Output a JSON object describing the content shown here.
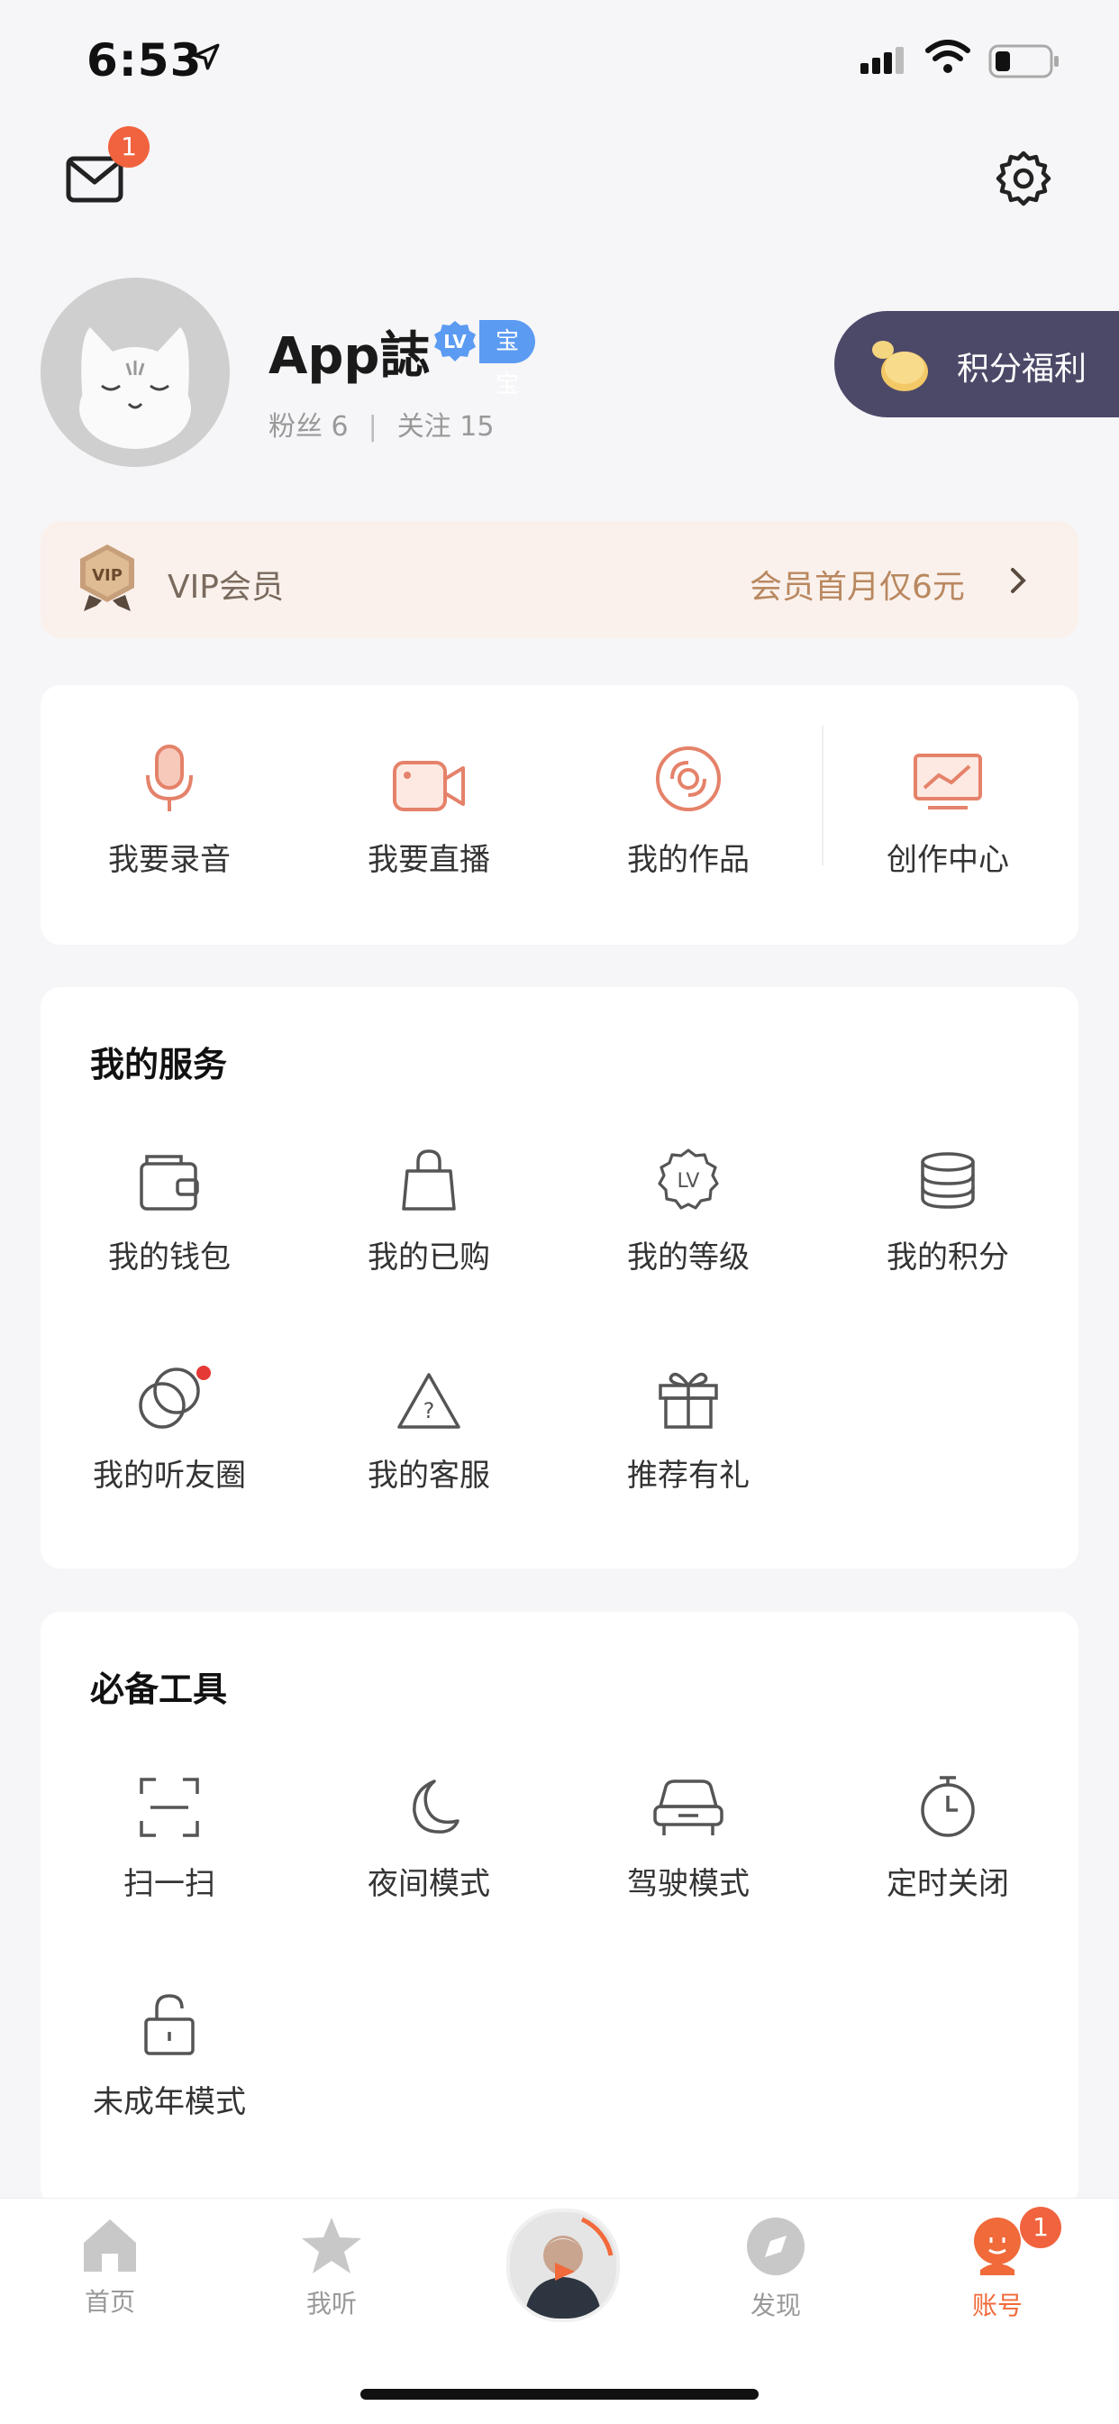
{
  "status_bar": {
    "time": "6:53"
  },
  "top_bar": {
    "mail_badge": "1"
  },
  "profile": {
    "name": "App誌",
    "level_badge": "LV",
    "level_label": "宝宝",
    "fans_label": "粉丝",
    "fans_count": "6",
    "following_label": "关注",
    "following_count": "15",
    "points_button": "积分福利"
  },
  "vip": {
    "badge": "VIP",
    "title": "VIP会员",
    "offer": "会员首月仅6元"
  },
  "creator": {
    "items": [
      {
        "label": "我要录音",
        "icon": "microphone-icon"
      },
      {
        "label": "我要直播",
        "icon": "video-camera-icon"
      },
      {
        "label": "我的作品",
        "icon": "disc-icon"
      },
      {
        "label": "创作中心",
        "icon": "monitor-chart-icon"
      }
    ]
  },
  "services": {
    "title": "我的服务",
    "items": [
      {
        "label": "我的钱包",
        "icon": "wallet-icon"
      },
      {
        "label": "我的已购",
        "icon": "shopping-bag-icon"
      },
      {
        "label": "我的等级",
        "icon": "level-badge-icon",
        "icon_text": "LV"
      },
      {
        "label": "我的积分",
        "icon": "coins-stack-icon"
      },
      {
        "label": "我的听友圈",
        "icon": "circles-icon"
      },
      {
        "label": "我的客服",
        "icon": "warning-triangle-icon"
      },
      {
        "label": "推荐有礼",
        "icon": "gift-icon"
      }
    ]
  },
  "tools": {
    "title": "必备工具",
    "items": [
      {
        "label": "扫一扫",
        "icon": "scan-icon"
      },
      {
        "label": "夜间模式",
        "icon": "moon-icon"
      },
      {
        "label": "驾驶模式",
        "icon": "car-icon"
      },
      {
        "label": "定时关闭",
        "icon": "timer-icon"
      },
      {
        "label": "未成年模式",
        "icon": "unlock-icon"
      }
    ]
  },
  "tabbar": {
    "items": [
      {
        "label": "首页",
        "icon": "home-icon"
      },
      {
        "label": "我听",
        "icon": "star-icon"
      },
      {
        "label": "发现",
        "icon": "compass-icon"
      },
      {
        "label": "账号",
        "icon": "account-icon"
      }
    ],
    "account_badge": "1"
  },
  "colors": {
    "accent": "#f06a3a",
    "icon_coral": "#e5826a",
    "badge_red": "#f0633e"
  }
}
